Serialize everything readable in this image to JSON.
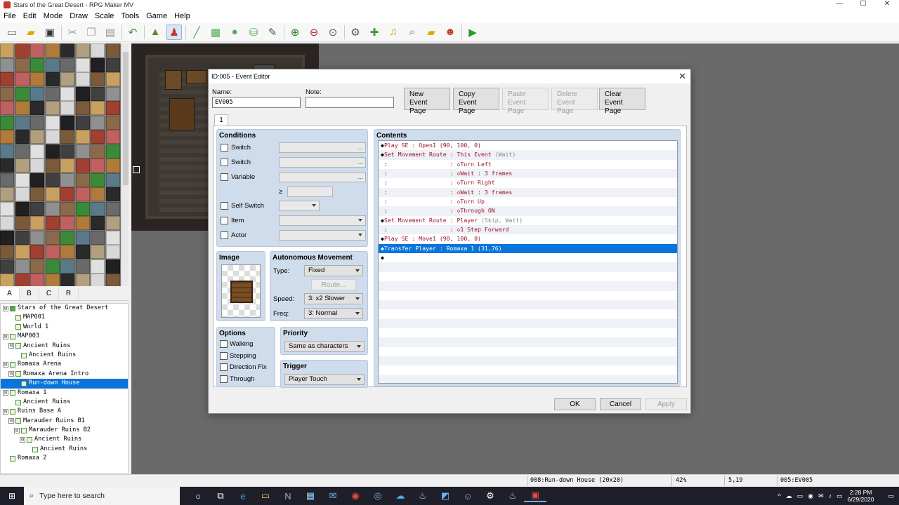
{
  "window": {
    "title": "Stars of the Great Desert - RPG Maker MV",
    "minimize": "—",
    "maximize": "☐",
    "close": "✕"
  },
  "menu": [
    "File",
    "Edit",
    "Mode",
    "Draw",
    "Scale",
    "Tools",
    "Game",
    "Help"
  ],
  "toolbar_icons": [
    "new-project-icon",
    "open-project-icon",
    "save-icon",
    "cut-icon",
    "copy-icon",
    "paste-icon",
    "undo-icon",
    "map-mode-icon",
    "event-mode-icon",
    "pencil-icon",
    "rectangle-icon",
    "ellipse-icon",
    "fill-icon",
    "shadow-pen-icon",
    "zoom-in-icon",
    "zoom-out-icon",
    "actual-size-icon",
    "database-icon",
    "plugin-manager-icon",
    "sound-test-icon",
    "event-searcher-icon",
    "resource-manager-icon",
    "character-generator-icon",
    "playtest-icon"
  ],
  "tileset_tabs": [
    "A",
    "B",
    "C",
    "R"
  ],
  "map_tree": [
    {
      "label": "Stars of the Great Desert",
      "depth": 0,
      "toggle": "⊟",
      "root": true
    },
    {
      "label": "MAP001",
      "depth": 1
    },
    {
      "label": "World 1",
      "depth": 1
    },
    {
      "label": "MAP003",
      "depth": 0,
      "toggle": "⊟"
    },
    {
      "label": "Ancient Ruins",
      "depth": 1,
      "toggle": "⊟"
    },
    {
      "label": "Ancient Ruins",
      "depth": 2
    },
    {
      "label": "Romaxa Arena",
      "depth": 0,
      "toggle": "⊟"
    },
    {
      "label": "Romaxa Arena Intro",
      "depth": 1,
      "toggle": "⊟"
    },
    {
      "label": "Run-down House",
      "depth": 2,
      "selected": true
    },
    {
      "label": "Romaxa 1",
      "depth": 0,
      "toggle": "⊟"
    },
    {
      "label": "Ancient Ruins",
      "depth": 1
    },
    {
      "label": "Ruins Base A",
      "depth": 0,
      "toggle": "⊟"
    },
    {
      "label": "Marauder Ruins B1",
      "depth": 1,
      "toggle": "⊟"
    },
    {
      "label": "Marauder Ruins B2",
      "depth": 2,
      "toggle": "⊟"
    },
    {
      "label": "Ancient Ruins",
      "depth": 3,
      "toggle": "⊟"
    },
    {
      "label": "Ancient Ruins",
      "depth": 4
    },
    {
      "label": "Romaxa 2",
      "depth": 0
    }
  ],
  "dialog": {
    "title": "ID:005 - Event Editor",
    "close": "✕",
    "name_label": "Name:",
    "name_value": "EV005",
    "note_label": "Note:",
    "note_value": "",
    "buttons": {
      "new_page": [
        "New",
        "Event Page"
      ],
      "copy_page": [
        "Copy",
        "Event Page"
      ],
      "paste_page": [
        "Paste",
        "Event Page"
      ],
      "delete_page": [
        "Delete",
        "Event Page"
      ],
      "clear_page": [
        "Clear",
        "Event Page"
      ],
      "ok": "OK",
      "cancel": "Cancel",
      "apply": "Apply"
    },
    "page_tab": "1",
    "conditions": {
      "title": "Conditions",
      "switch1": "Switch",
      "switch2": "Switch",
      "variable": "Variable",
      "gte": "≥",
      "self_switch": "Self Switch",
      "item": "Item",
      "actor": "Actor",
      "dots": "..."
    },
    "image": {
      "title": "Image"
    },
    "autonomous": {
      "title": "Autonomous Movement",
      "type_label": "Type:",
      "type_value": "Fixed",
      "route_button": "Route...",
      "speed_label": "Speed:",
      "speed_value": "3: x2 Slower",
      "freq_label": "Freq:",
      "freq_value": "3: Normal"
    },
    "options": {
      "title": "Options",
      "walking": "Walking",
      "stepping": "Stepping",
      "direction_fix": "Direction Fix",
      "through": "Through"
    },
    "priority": {
      "title": "Priority",
      "value": "Same as characters"
    },
    "trigger": {
      "title": "Trigger",
      "value": "Player Touch"
    },
    "contents": {
      "title": "Contents",
      "rows": [
        {
          "sym": "◆",
          "cmd": "Play SE",
          "sep": " : ",
          "args": "Open1 (90, 100, 0)",
          "extra": ""
        },
        {
          "sym": "◆",
          "cmd": "Set Movement Route",
          "sep": " : ",
          "args": "This Event ",
          "extra": "(Wait)"
        },
        {
          "sym": " :",
          "cmd": "",
          "sep": "                  : ",
          "args": "◇Turn Left",
          "extra": ""
        },
        {
          "sym": " :",
          "cmd": "",
          "sep": "                  : ",
          "args": "◇Wait : 3 frames",
          "extra": ""
        },
        {
          "sym": " :",
          "cmd": "",
          "sep": "                  : ",
          "args": "◇Turn Right",
          "extra": ""
        },
        {
          "sym": " :",
          "cmd": "",
          "sep": "                  : ",
          "args": "◇Wait : 3 frames",
          "extra": ""
        },
        {
          "sym": " :",
          "cmd": "",
          "sep": "                  : ",
          "args": "◇Turn Up",
          "extra": ""
        },
        {
          "sym": " :",
          "cmd": "",
          "sep": "                  : ",
          "args": "◇Through ON",
          "extra": ""
        },
        {
          "sym": "◆",
          "cmd": "Set Movement Route",
          "sep": " : ",
          "args": "Player ",
          "extra": "(Skip, Wait)"
        },
        {
          "sym": " :",
          "cmd": "",
          "sep": "                  : ",
          "args": "◇1 Step Forward",
          "extra": ""
        },
        {
          "sym": "◆",
          "cmd": "Play SE",
          "sep": " : ",
          "args": "Move1 (90, 100, 0)",
          "extra": ""
        },
        {
          "sym": "◆",
          "cmd": "Transfer Player",
          "sep": " : ",
          "args": "Romaxa 1 (31,76)",
          "extra": "",
          "selected": true
        },
        {
          "sym": "◆",
          "cmd": "",
          "sep": "",
          "args": "",
          "extra": ""
        }
      ]
    }
  },
  "status": {
    "map": "008:Run-down House (20x20)",
    "zoom": "42%",
    "coords": "5,19",
    "event": "005:EV005"
  },
  "taskbar": {
    "start": "⊞",
    "search_placeholder": "Type here to search",
    "search_icon": "⌕",
    "apps": [
      "○",
      "⧉",
      "e",
      "▭",
      "N",
      "▦",
      "✉",
      "◉",
      "◎",
      "☁",
      "♨",
      "◩",
      "☺",
      "⚙",
      "♨",
      "▣"
    ],
    "tray": [
      "^",
      "☁",
      "▭",
      "◉",
      "✉",
      "♪",
      "▭"
    ],
    "time": "2:28 PM",
    "date": "6/29/2020",
    "notify": "▭"
  },
  "colors": {
    "accent": "#0a74da",
    "command_text": "#a01030",
    "group_bg": "#cfdcec"
  }
}
